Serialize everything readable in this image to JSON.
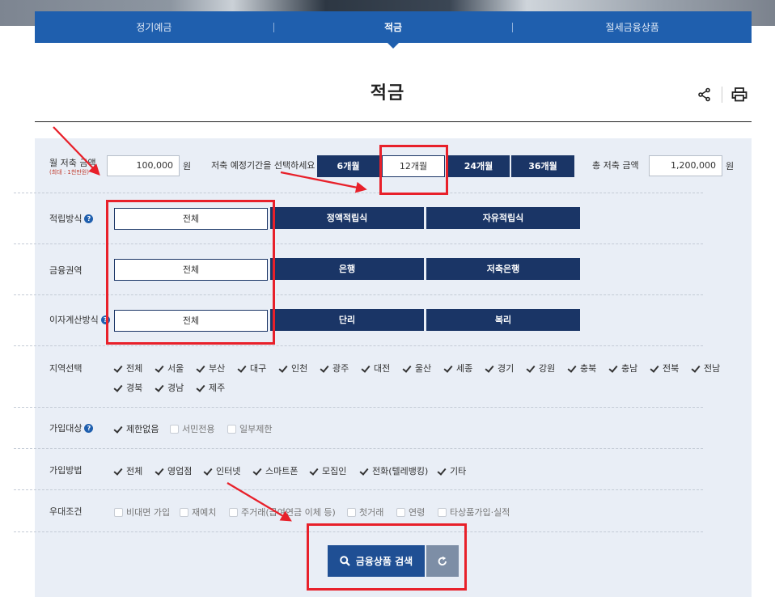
{
  "tabs": [
    {
      "label": "정기예금"
    },
    {
      "label": "적금"
    },
    {
      "label": "절세금융상품"
    }
  ],
  "page_title": "적금",
  "toolbar": {
    "share_icon": "share-icon",
    "print_icon": "print-icon"
  },
  "savings": {
    "monthly_label": "월 저축 금액",
    "monthly_note": "(최대 : 1천만원)",
    "monthly_value": "100,000",
    "unit": "원",
    "period_label": "저축 예정기간을 선택하세요",
    "periods": [
      "6개월",
      "12개월",
      "24개월",
      "36개월"
    ],
    "selected_period": "12개월",
    "total_label": "총 저축 금액",
    "total_value": "1,200,000"
  },
  "accumulation": {
    "label": "적립방식",
    "options": [
      "전체",
      "정액적립식",
      "자유적립식"
    ]
  },
  "sector": {
    "label": "금융권역",
    "options": [
      "전체",
      "은행",
      "저축은행"
    ]
  },
  "interest": {
    "label": "이자계산방식",
    "options": [
      "전체",
      "단리",
      "복리"
    ]
  },
  "region": {
    "label": "지역선택",
    "items": [
      "전체",
      "서울",
      "부산",
      "대구",
      "인천",
      "광주",
      "대전",
      "울산",
      "세종",
      "경기",
      "강원",
      "충북",
      "충남",
      "전북",
      "전남",
      "경북",
      "경남",
      "제주"
    ]
  },
  "target": {
    "label": "가입대상",
    "items": [
      "제한없음",
      "서민전용",
      "일부제한"
    ],
    "checked": [
      true,
      false,
      false
    ]
  },
  "method": {
    "label": "가입방법",
    "items": [
      "전체",
      "영업점",
      "인터넷",
      "스마트폰",
      "모집인",
      "전화(텔레뱅킹)",
      "기타"
    ]
  },
  "preferential": {
    "label": "우대조건",
    "items": [
      "비대면 가입",
      "재예치",
      "주거래(급여연금 이체 등)",
      "첫거래",
      "연령",
      "타상품가입·실적"
    ]
  },
  "search_button": {
    "label": "금융상품 검색"
  },
  "colors": {
    "tab_blue": "#1f5fae",
    "navy": "#1a3566",
    "panel": "#e9eef6",
    "annotation_red": "#e8202a"
  }
}
